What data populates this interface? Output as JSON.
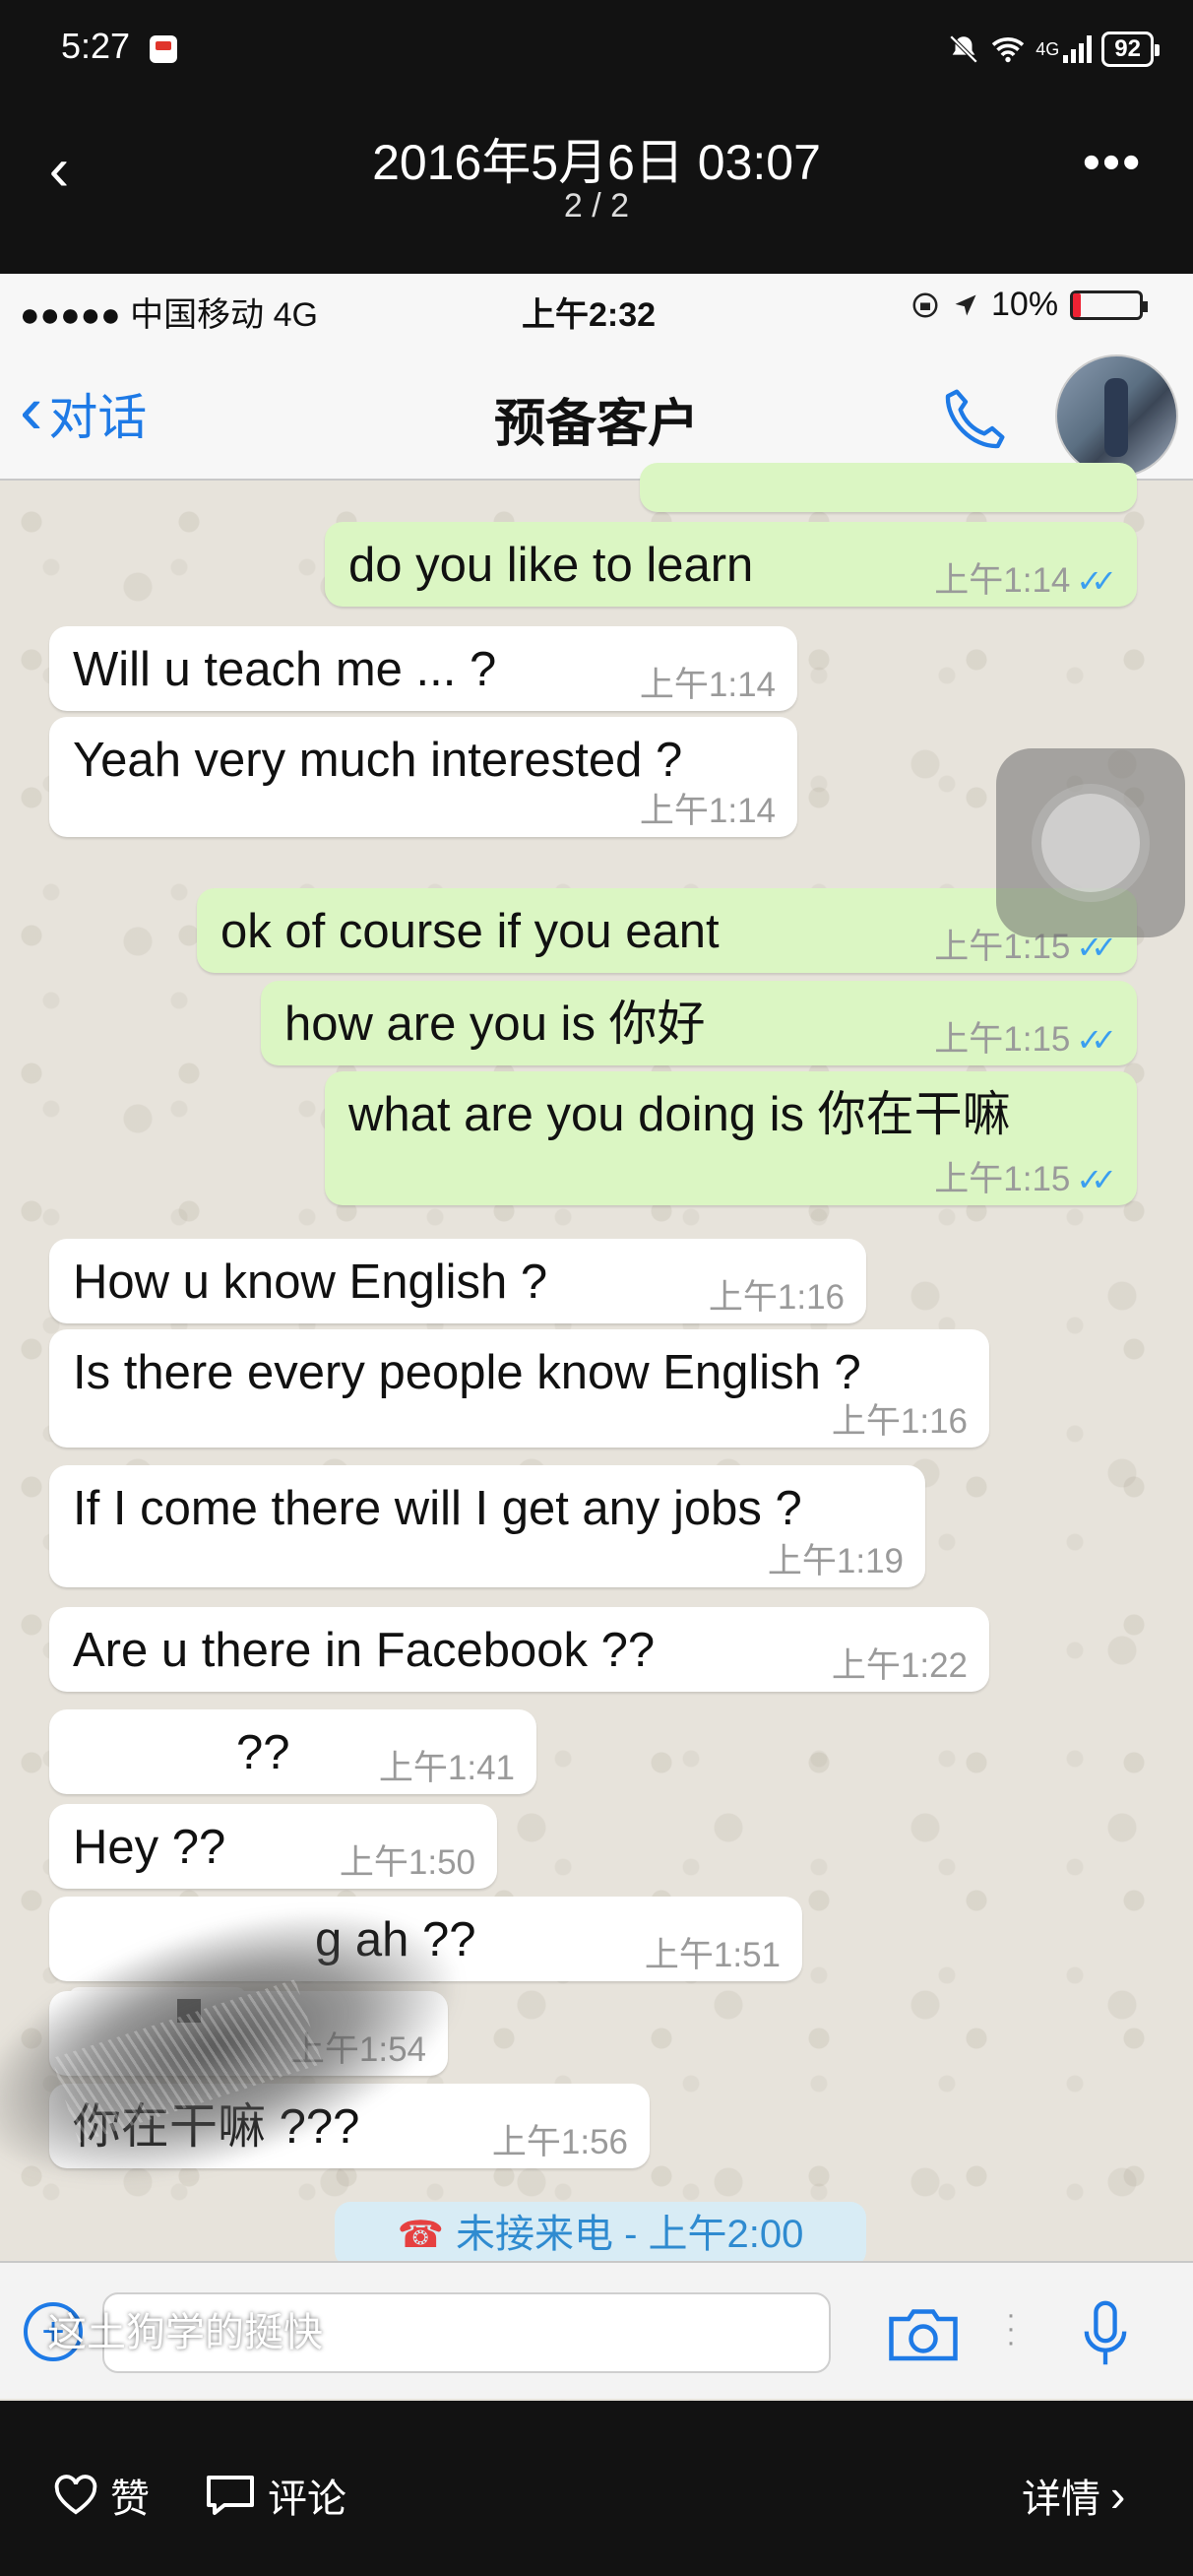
{
  "phone_status": {
    "time": "5:27",
    "battery": "92",
    "network": "4G"
  },
  "viewer": {
    "back_icon": "back-chevron-icon",
    "date": "2016年5月6日 03:07",
    "page": "2 / 2",
    "more_icon": "more-dots-icon"
  },
  "screenshot": {
    "status": {
      "carrier": "●●●●● 中国移动  4G",
      "time": "上午2:32",
      "battery": "10%"
    },
    "nav": {
      "back_label": "对话",
      "title": "预备客户"
    },
    "messages": [
      {
        "dir": "out",
        "text": "do you like to learn",
        "time": "上午1:14"
      },
      {
        "dir": "in",
        "text": "Will u teach me ... ?",
        "time": "上午1:14"
      },
      {
        "dir": "in",
        "text": "Yeah very much interested ?",
        "time": "上午1:14"
      },
      {
        "dir": "out",
        "text": "ok of course if you eant",
        "time": "上午1:15"
      },
      {
        "dir": "out",
        "text": "how are you  is 你好",
        "time": "上午1:15"
      },
      {
        "dir": "out",
        "text": "what are you doing is 你在干嘛",
        "time": "上午1:15"
      },
      {
        "dir": "in",
        "text": "How u know English ?",
        "time": "上午1:16"
      },
      {
        "dir": "in",
        "text": "Is there every people know English ?",
        "time": "上午1:16"
      },
      {
        "dir": "in",
        "text": "If I come there will I get any jobs ?",
        "time": "上午1:19"
      },
      {
        "dir": "in",
        "text": "Are u there in Facebook ??",
        "time": "上午1:22"
      },
      {
        "dir": "in",
        "text": "??",
        "time": "上午1:41"
      },
      {
        "dir": "in",
        "text": "Hey ??",
        "time": "上午1:50"
      },
      {
        "dir": "in",
        "text": "g ah ??",
        "time": "上午1:51"
      },
      {
        "dir": "in",
        "text": "",
        "time": "上午1:54"
      },
      {
        "dir": "in",
        "text": "你在干嘛 ???",
        "time": "上午1:56"
      }
    ],
    "missed_call": "未接来电 - 上午2:00"
  },
  "comment_overlay": "这土狗学的挺快",
  "bottom": {
    "like_label": "赞",
    "comment_label": "评论",
    "details_label": "详情"
  },
  "colors": {
    "accent": "#1e7ae6",
    "outgoing_bubble": "#dbf6c3",
    "read_ticks": "#3a9ef0"
  }
}
